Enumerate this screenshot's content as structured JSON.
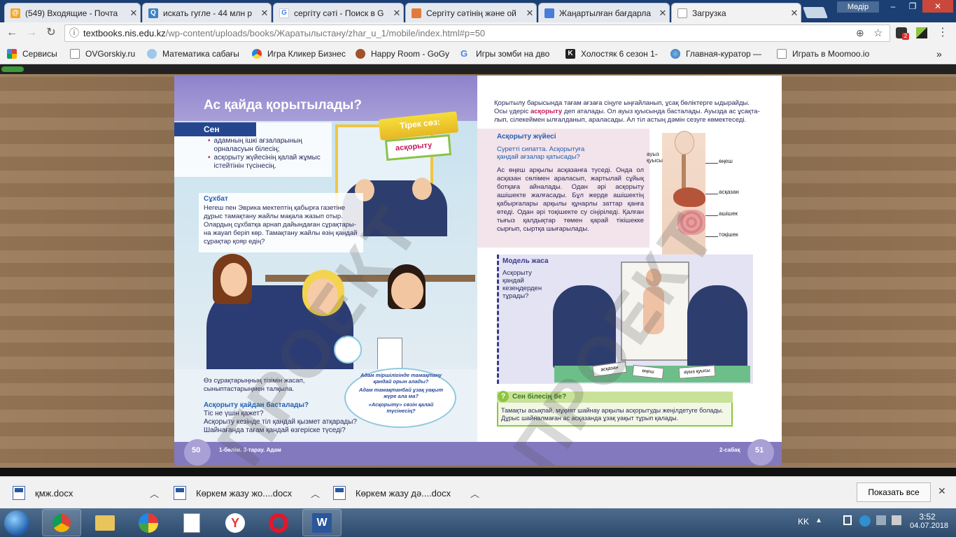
{
  "tabs": [
    {
      "title": "(549) Входящие - Почта",
      "icon": "mail-icon",
      "color": "#f6a623"
    },
    {
      "title": "искать гугле - 44 млн р",
      "icon": "search-icon",
      "color": "#3b82c4"
    },
    {
      "title": "сергіту сәті - Поиск в G",
      "icon": "google-icon",
      "color": "#4285f4"
    },
    {
      "title": "Сергіту сәтінің және ой",
      "icon": "page-icon",
      "color": "#e07b39"
    },
    {
      "title": "Жаңартылған бағдарла",
      "icon": "doc-icon",
      "color": "#4a7ed6"
    },
    {
      "title": "Загрузка",
      "icon": "page-icon",
      "color": "#9aa3ad"
    }
  ],
  "window": {
    "user": "Мөдір",
    "min": "–",
    "max": "❐",
    "close": "✕"
  },
  "toolbar": {
    "url_host": "textbooks.nis.edu.kz",
    "url_rest": "/wp-content/uploads/books/Жаратылыстану/zhar_u_1/mobile/index.html#p=50",
    "back": "←",
    "forward": "→",
    "reload": "↻",
    "info": "ⓘ",
    "zoom": "⊕",
    "star": "☆",
    "menu": "⋮",
    "ext_badge": "2"
  },
  "bookmarks": [
    {
      "label": "Сервисы",
      "icon": "apps-icon"
    },
    {
      "label": "OVGorskiy.ru",
      "icon": "page-icon"
    },
    {
      "label": "Математика сабағы",
      "icon": "bookmark-icon"
    },
    {
      "label": "Игра Кликер Бизнес",
      "icon": "bookmark-icon"
    },
    {
      "label": "Happy Room - GoGy",
      "icon": "bookmark-icon"
    },
    {
      "label": "Игры зомби на дво",
      "icon": "google-icon"
    },
    {
      "label": "Холостяк 6 сезон 1-",
      "icon": "k-icon"
    },
    {
      "label": "Главная-куратор —",
      "icon": "globe-icon"
    },
    {
      "label": "Играть в Moomoo.io",
      "icon": "page-icon"
    }
  ],
  "left": {
    "title": "Ас қайда қорытылады?",
    "sen": "Сен",
    "sen_items": [
      "адамның ішкі ағзаларының орналасуын білесің;",
      "асқорыту жүйесінің қалай жұмыс істейтінін түсінесің."
    ],
    "tirek": "Тірек сөз:",
    "tirek_word": "асқорыту",
    "suhbat_h": "Сұхбат",
    "suhbat_text": "Негеш пен Эврика мектептің қабырға газетіне дұрыс тамақтану жайлы мақала жазып отыр. Олардың сұхбатқа арнап дайындаған сұрақтары-на жауап беріп көр. Тамақтану жайлы өзің қандай сұрақтар қояр едің?",
    "task": "Өз сұрақтарыңның тізімін жасап, сыныптастарыңмен талқыла.",
    "q_h": "Асқорыту қайдан басталады?",
    "questions": [
      "Тіс не үшін қажет?",
      "Асқорыту кезінде тіл  қандай қызмет атқарады?",
      "Шайнағанда тағам қандай өзгеріске түседі?"
    ],
    "bubble": [
      "Адам тіршілігінде тамақтану қандай орын алады?",
      "Адам тамақтанбай ұзақ уақыт жүре ала ма?",
      "«Асқорыту» сөзін қалай түсінесің?"
    ],
    "page_num": "50",
    "footer": "1-бөлім. 3-тарау. Адам"
  },
  "right": {
    "intro": "Қорытылу барысында тағам ағзаға сіңуге ыңғайланып, ұсақ бөліктерге ыдырайды. Осы үдеріс",
    "intro_hl": "асқорыту",
    "intro2": "деп аталады. Ол ауыз қуысында басталады. Ауызда ас ұсақта-лып, сілекеймен ылғалданып, араласады. Ал тіл астың дәмін сезуге көмектеседі.",
    "system_h": "Асқорыту жүйесі",
    "picture_q": "Суретті сипатта. Асқорытуға қандай ағзалар қатысады?",
    "system_text": "Ас өңеш арқылы асқазанға түседі. Онда ол асқазан сөлімен араласып, жартылай сұйық ботқаға айналады. Одан әрі асқорыту ашішекте жалғасады. Бұл жерде ашішектің қабырғалары арқылы құнарлы заттар қанға өтеді. Одан әрі тоқішекте су сіңіріледі. Қалған тығыз қалдықтар төмен қарай тікішекке сырғып, сыртқа шығарылады.",
    "organs": [
      "ауыз қуысы",
      "өңеш",
      "асқазан",
      "ашішек",
      "тоқішек"
    ],
    "model_h": "Модель жаса",
    "model_q": "Асқорыту қандай кезеңдерден тұрады?",
    "cards": [
      "асқазан",
      "өңеш",
      "ауыз қуысы"
    ],
    "know_h": "Сен білесің бе?",
    "know_icon": "?",
    "know_text": "Тамақты асықпай, мұқият шайнау арқылы асқорытуды жеңілдетуге болады. Дұрыс шайналмаған ас асқазанда ұзақ уақыт тұрып қалады.",
    "page_num": "51",
    "footer": "2-сабақ"
  },
  "watermark": "ПРОЕКТ",
  "downloads": [
    {
      "name": "қмж.docx"
    },
    {
      "name": "Көркем жазу жо....docx"
    },
    {
      "name": "Көркем жазу дә....docx"
    }
  ],
  "show_all": "Показать все",
  "taskbar": {
    "lang": "KK",
    "time": "3:52",
    "date": "04.07.2018"
  },
  "colors": {
    "titlebar": "#1b3f73",
    "purple": "#7d71c0",
    "blue_head": "#2360b0",
    "green": "#8dc63f"
  }
}
